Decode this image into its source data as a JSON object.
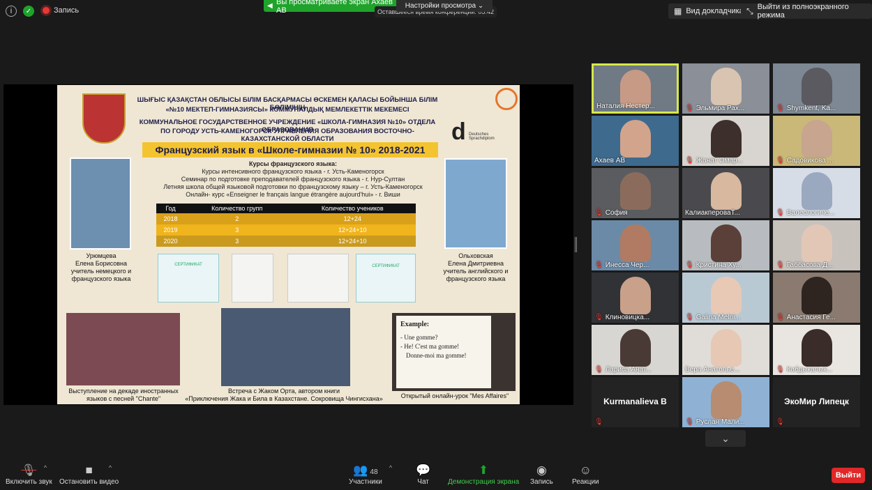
{
  "top": {
    "info_icon": "info-icon",
    "shield_icon": "shield-icon",
    "record_label": "Запись",
    "sharing_banner": "Вы просматриваете экран Ахаев АВ",
    "view_settings": "Настройки просмотра ⌄",
    "remaining_time": "Оставшееся время конференции: 05:42",
    "speaker_view": "Вид докладчика",
    "exit_fullscreen": "Выйти из полноэкранного режима"
  },
  "slide": {
    "header_line1": "ШЫҒЫС ҚАЗАҚСТАН ОБЛЫСЫ БІЛІМ БАСҚАРМАСЫ ӨСКЕМЕН ҚАЛАСЫ БОЙЫНША БІЛІМ БӨЛІМІНІҢ",
    "header_line2": "«№10 МЕКТЕП-ГИМНАЗИЯСЫ» КОММУНАЛДЫҚ МЕМЛЕКЕТТІК МЕКЕМЕСІ",
    "header_line3": "КОММУНАЛЬНОЕ ГОСУДАРСТВЕННОЕ УЧРЕЖДЕНИЕ «ШКОЛА-ГИМНАЗИЯ №10» ОТДЕЛА ОБРАЗОВАНИЯ",
    "header_line4": "ПО ГОРОДУ УСТЬ-КАМЕНОГОРСК УПРАВЛЕНИЯ ОБРАЗОВАНИЯ ВОСТОЧНО-КАЗАХСТАНСКОЙ ОБЛАСТИ",
    "title": "Французский язык в «Школе-гимназии № 10» 2018-2021",
    "courses_heading": "Курсы французского языка:",
    "courses": [
      "Курсы интенсивного французского языка - г. Усть-Каменогорск",
      "Семинар по подготовке преподавателей французского языка - г. Нур-Султан",
      "Летняя школа общей языковой подготовки по французскому языку – г. Усть-Каменогорск",
      "Онлайн- курс «Enseigner le français langue étrangère aujourd'hui» - г. Виши"
    ],
    "table": {
      "headers": [
        "Год",
        "Количество групп",
        "Количество учеников"
      ],
      "rows": [
        [
          "2018",
          "2",
          "12+24"
        ],
        [
          "2019",
          "3",
          "12+24+10"
        ],
        [
          "2020",
          "3",
          "12+24+10"
        ]
      ],
      "row_colors": [
        "#d9a11a",
        "#f0b41c",
        "#c99a1e"
      ]
    },
    "teacher_left": [
      "Урюмцева",
      "Елена Борисовна",
      "учитель немецкого и",
      "французского языка"
    ],
    "teacher_right": [
      "Ольховская",
      "Елена Дмитриевна",
      "учитель английского и",
      "французского языка"
    ],
    "cert_label": "СЕРТИФИКАТ",
    "caption_left": [
      "Выступление на декаде иностранных",
      "языков с песней \"Chante\""
    ],
    "caption_mid": [
      "Встреча с Жаком Орта, автором книги",
      "«Приключения Жака и Била в Казахстане. Сокровища Чингисхана»"
    ],
    "caption_right": "Открытый онлайн-урок \"Mes Affaires\"",
    "example_title": "Example:",
    "example_lines": [
      "- Une gomme?",
      "- He! C'est ma gomme!",
      "Donne-moi ma gomme!"
    ],
    "logo_d": "d",
    "logo_d_sub": "Deutsches Sprachdiplom"
  },
  "participants": [
    {
      "name": "Наталия Нестер...",
      "muted": false,
      "active": true,
      "bg": "#6f7a85",
      "face": "#c79a86"
    },
    {
      "name": "Эльмира Рах...",
      "muted": true,
      "bg": "#8a8f98",
      "face": "#d8c4b0"
    },
    {
      "name": "Shymkent, Ka...",
      "muted": true,
      "bg": "#7d8894",
      "face": "#5a5a60"
    },
    {
      "name": "Ахаев АВ",
      "muted": false,
      "bg": "#3e6a8e",
      "face": "#d2a48c"
    },
    {
      "name": "Жанат Омар...",
      "muted": true,
      "bg": "#d8d4cf",
      "face": "#3c2f2c"
    },
    {
      "name": "Садовикова ...",
      "muted": true,
      "bg": "#c9b878",
      "face": "#c8a58e"
    },
    {
      "name": "София",
      "muted": true,
      "bg": "#5a5c60",
      "face": "#8b6c5c"
    },
    {
      "name": "КалиакпероваТ...",
      "muted": false,
      "bg": "#4a4a4e",
      "face": "#d9b8a0"
    },
    {
      "name": "Валеологиче...",
      "muted": true,
      "bg": "#d6dde6",
      "face": "#9aa9c0"
    },
    {
      "name": "Инесса Чер...",
      "muted": true,
      "bg": "#6b8aa8",
      "face": "#b07b62"
    },
    {
      "name": "Кристина Ху...",
      "muted": true,
      "bg": "#b8bcc0",
      "face": "#5a4038"
    },
    {
      "name": "Габбасова Д...",
      "muted": true,
      "bg": "#c8c2bd",
      "face": "#e2c7b7"
    },
    {
      "name": "Клиновицка...",
      "muted": true,
      "bg": "#303236",
      "face": "#c9a08a"
    },
    {
      "name": "Galina Melni...",
      "muted": true,
      "bg": "#b9c9d4",
      "face": "#e8c9b5"
    },
    {
      "name": "Анастасия Ге...",
      "muted": true,
      "bg": "#8a7a70",
      "face": "#2e2420"
    },
    {
      "name": "Лариса Анат...",
      "muted": true,
      "bg": "#d8d6d2",
      "face": "#4a3a36"
    },
    {
      "name": "Вера Анатолье...",
      "muted": false,
      "bg": "#e0ddd8",
      "face": "#e6c8b4"
    },
    {
      "name": "Кабдыкалык...",
      "muted": true,
      "bg": "#e9e6e2",
      "face": "#3a2c28"
    },
    {
      "name": "Kurmanalieva B",
      "muted": true,
      "video": false
    },
    {
      "name": "Руслан Мали...",
      "muted": true,
      "bg": "#8fb2d4",
      "face": "#b88c70"
    },
    {
      "name": "ЭкоМир Липецк",
      "muted": true,
      "video": false
    }
  ],
  "toolbar": {
    "unmute": "Включить звук",
    "stop_video": "Остановить видео",
    "participants": "Участники",
    "participants_count": "48",
    "chat": "Чат",
    "share_screen": "Демонстрация экрана",
    "record": "Запись",
    "reactions": "Реакции",
    "leave": "Выйти",
    "accent_green": "#1fa32b",
    "leave_red": "#e02828"
  }
}
